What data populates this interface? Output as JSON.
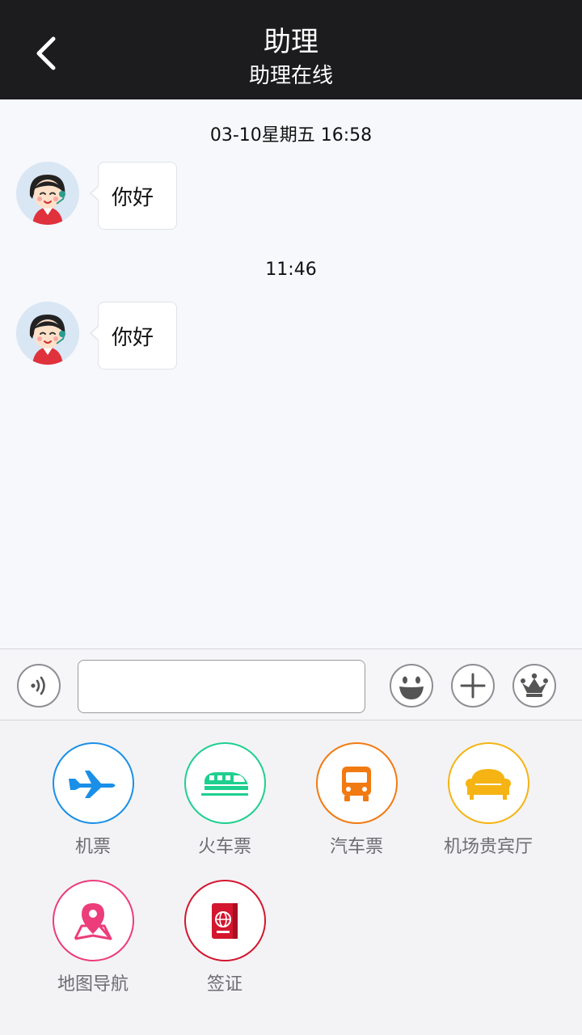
{
  "header": {
    "title": "助理",
    "subtitle": "助理在线",
    "back_icon": "chevron-left-icon"
  },
  "chat": {
    "messages": [
      {
        "timestamp": "03-10星期五 16:58",
        "text": "你好",
        "sender": "assistant"
      },
      {
        "timestamp": "11:46",
        "text": "你好",
        "sender": "assistant"
      }
    ]
  },
  "input_bar": {
    "voice_icon": "voice-icon",
    "input_value": "",
    "emoji_icon": "emoji-icon",
    "plus_icon": "plus-icon",
    "crown_icon": "crown-icon"
  },
  "services": [
    {
      "label": "机票",
      "icon": "airplane-icon",
      "color": "#1a8fe8"
    },
    {
      "label": "火车票",
      "icon": "train-icon",
      "color": "#1fcf8f"
    },
    {
      "label": "汽车票",
      "icon": "bus-icon",
      "color": "#f27a12"
    },
    {
      "label": "机场贵宾厅",
      "icon": "sofa-icon",
      "color": "#f5b413"
    },
    {
      "label": "地图导航",
      "icon": "map-pin-icon",
      "color": "#ec3c7a"
    },
    {
      "label": "签证",
      "icon": "passport-icon",
      "color": "#d4162f"
    }
  ]
}
